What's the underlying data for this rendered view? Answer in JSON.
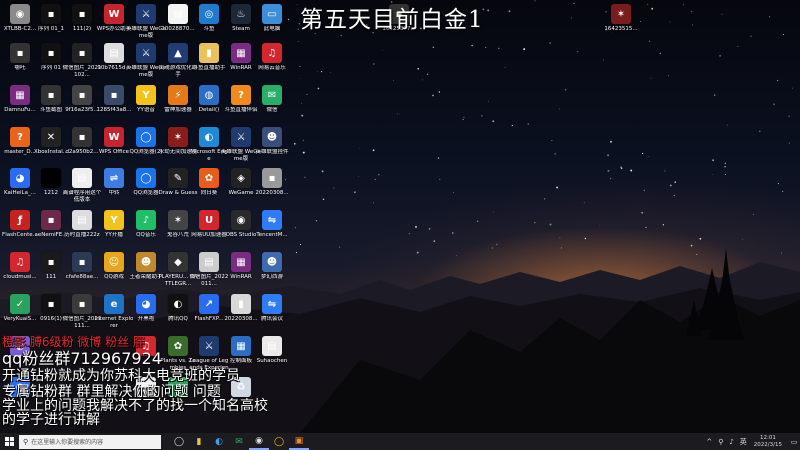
{
  "stream_title": "第五天目前白金1",
  "overlay": {
    "credit_line": "橙影.膊6级粉 微博 粉丝 胖",
    "qq_group": "qq粉丝群712967924",
    "line2": "开通钻粉就成为你苏科大电竞班的学员",
    "line3": "专属钻粉群 群里解决你的问题 问题",
    "line4": "学业上的问题我解决不了的找一个知名高校",
    "line5": "的学子进行讲解"
  },
  "desktop_icons": [
    {
      "id": "xtlbb",
      "label": "XTLBB-C2...",
      "icon": "disc-icon",
      "color": "#8a8a8a",
      "glyph": "◉"
    },
    {
      "id": "xulie1",
      "label": "序列 01_1",
      "icon": "video-file-icon",
      "color": "#111111",
      "glyph": "▪"
    },
    {
      "id": "f111",
      "label": "111(2)",
      "icon": "video-file-icon",
      "color": "#111111",
      "glyph": "▪"
    },
    {
      "id": "wpsyun",
      "label": "WPS办公助手",
      "icon": "wps-icon",
      "color": "#c8242d",
      "glyph": "W"
    },
    {
      "id": "lol-wegame",
      "label": "英雄联盟 WeGame版",
      "icon": "lol-icon",
      "color": "#1e3a6e",
      "glyph": "⚔"
    },
    {
      "id": "f10028",
      "label": "10028870...",
      "icon": "document-icon",
      "color": "#f4f4f4",
      "glyph": "▤"
    },
    {
      "id": "douyu",
      "label": "斗鱼",
      "icon": "edge-like-icon",
      "color": "#1f7ad0",
      "glyph": "◎"
    },
    {
      "id": "steam",
      "label": "Steam",
      "icon": "steam-icon",
      "color": "#1b2838",
      "glyph": "♨"
    },
    {
      "id": "thispc",
      "label": "此电脑",
      "icon": "computer-icon",
      "color": "#3c8ed8",
      "glyph": "▭"
    },
    {
      "id": "nezha",
      "label": "哪吒",
      "icon": "video-file-icon",
      "color": "#333333",
      "glyph": "▪"
    },
    {
      "id": "xulie01",
      "label": "序列 01",
      "icon": "video-file-icon",
      "color": "#111111",
      "glyph": "▪"
    },
    {
      "id": "wxtp",
      "label": "微信图片_2021102...",
      "icon": "image-file-icon",
      "color": "#222222",
      "glyph": "▪"
    },
    {
      "id": "f90b",
      "label": "90b7615d...",
      "icon": "image-file-icon",
      "color": "#dddddd",
      "glyph": "▤"
    },
    {
      "id": "lol-wegame2",
      "label": "英雄联盟 WeGame版",
      "icon": "lol-icon",
      "color": "#1e3a6e",
      "glyph": "⚔"
    },
    {
      "id": "lolhelper",
      "label": "灵魂游戏优化助手",
      "icon": "triangle-app-icon",
      "color": "#233b73",
      "glyph": "▲"
    },
    {
      "id": "douyuzb",
      "label": "斗鱼直播助手",
      "icon": "folder-icon",
      "color": "#e9c25a",
      "glyph": "▮"
    },
    {
      "id": "winrar",
      "label": "WinRAR",
      "icon": "winrar-icon",
      "color": "#7a2b82",
      "glyph": "▦"
    },
    {
      "id": "neteasemusic",
      "label": "网易云音乐",
      "icon": "music-icon",
      "color": "#d4262f",
      "glyph": "♫"
    },
    {
      "id": "damnfu",
      "label": "DamnuFu...",
      "icon": "winrar-icon",
      "color": "#7a2b82",
      "glyph": "▦"
    },
    {
      "id": "douyushot",
      "label": "斗鱼截图",
      "icon": "image-file-icon",
      "color": "#333333",
      "glyph": "▪"
    },
    {
      "id": "f9a",
      "label": "9f16a23f5...",
      "icon": "image-file-icon",
      "color": "#444444",
      "glyph": "▪"
    },
    {
      "id": "f128",
      "label": "1285f43a8...",
      "icon": "image-file-icon",
      "color": "#3a4a6a",
      "glyph": "▪"
    },
    {
      "id": "yy",
      "label": "YY语音",
      "icon": "yy-icon",
      "color": "#f2c31a",
      "glyph": "Y"
    },
    {
      "id": "leishen",
      "label": "雷神加速器",
      "icon": "thunder-icon",
      "color": "#e37a1a",
      "glyph": "⚡"
    },
    {
      "id": "detail",
      "label": "Detail()",
      "icon": "globe-icon",
      "color": "#2b6cc4",
      "glyph": "◍"
    },
    {
      "id": "douyuzbj",
      "label": "斗鱼直播伴侣",
      "icon": "douyu-icon",
      "color": "#f08a1c",
      "glyph": "?"
    },
    {
      "id": "wechat",
      "label": "微信",
      "icon": "wechat-icon",
      "color": "#2aae67",
      "glyph": "✉"
    },
    {
      "id": "master",
      "label": "master_D...",
      "icon": "app-icon",
      "color": "#e8631c",
      "glyph": "?"
    },
    {
      "id": "xbox",
      "label": "XboxInstal...",
      "icon": "xbox-icon",
      "color": "#222222",
      "glyph": "✕"
    },
    {
      "id": "d2",
      "label": "d2a950b2...",
      "icon": "image-file-icon",
      "color": "#333333",
      "glyph": "▪"
    },
    {
      "id": "wps",
      "label": "WPS Office",
      "icon": "wps-icon",
      "color": "#c8242d",
      "glyph": "W"
    },
    {
      "id": "qqbrowser",
      "label": "QQ浏览器(2)",
      "icon": "qq-browser-icon",
      "color": "#1a73e8",
      "glyph": "◯"
    },
    {
      "id": "yongjie",
      "label": "永劫无间加速器",
      "icon": "game-icon",
      "color": "#8a1c1c",
      "glyph": "✶"
    },
    {
      "id": "msedge",
      "label": "Microsoft Edge",
      "icon": "edge-icon",
      "color": "#1e8ad6",
      "glyph": "◐"
    },
    {
      "id": "lol3",
      "label": "英雄联盟 WeGame版",
      "icon": "lol-icon",
      "color": "#1e3a6e",
      "glyph": "⚔"
    },
    {
      "id": "jiadian",
      "label": "英雄联盟挂件",
      "icon": "character-icon",
      "color": "#3a4e7a",
      "glyph": "☻"
    },
    {
      "id": "kaiheila",
      "label": "KaiHeiLa_...",
      "icon": "kaiheila-icon",
      "color": "#2a6cf0",
      "glyph": "◕"
    },
    {
      "id": "f1212",
      "label": "1212",
      "icon": "blank-file-icon",
      "color": "#000000",
      "glyph": ""
    },
    {
      "id": "yingyong",
      "label": "离谱程序用这个低版本",
      "icon": "document-icon",
      "color": "#eeeeee",
      "glyph": "▤"
    },
    {
      "id": "zhongxin",
      "label": "中转",
      "icon": "app-icon",
      "color": "#3b7de0",
      "glyph": "⇌"
    },
    {
      "id": "qqbrowser2",
      "label": "QQ浏览器",
      "icon": "qq-browser-icon",
      "color": "#1a73e8",
      "glyph": "◯"
    },
    {
      "id": "drawguess",
      "label": "Draw & Guess",
      "icon": "pen-icon",
      "color": "#222222",
      "glyph": "✎"
    },
    {
      "id": "xiangrile",
      "label": "向日葵",
      "icon": "sunflower-icon",
      "color": "#e85c1c",
      "glyph": "✿"
    },
    {
      "id": "wegame",
      "label": "WeGame",
      "icon": "wegame-icon",
      "color": "#222222",
      "glyph": "◈"
    },
    {
      "id": "f202203",
      "label": "20220308...",
      "icon": "image-file-icon",
      "color": "#999999",
      "glyph": "▪"
    },
    {
      "id": "flashcenter",
      "label": "FlashCente...",
      "icon": "flash-icon",
      "color": "#c82121",
      "glyph": "ƒ"
    },
    {
      "id": "aeriemini",
      "label": "aeNemiFE...",
      "icon": "photo-icon",
      "color": "#6b2a4a",
      "glyph": "▪"
    },
    {
      "id": "fyyy",
      "label": "历时直播222z",
      "icon": "text-file-icon",
      "color": "#dddddd",
      "glyph": "▤"
    },
    {
      "id": "yykaibo",
      "label": "YY开播",
      "icon": "yy-icon",
      "color": "#f2c31a",
      "glyph": "Y"
    },
    {
      "id": "qqmusic",
      "label": "QQ音乐",
      "icon": "qq-music-icon",
      "color": "#1fbf67",
      "glyph": "♪"
    },
    {
      "id": "guiyu",
      "label": "鬼谷八荒",
      "icon": "game-icon",
      "color": "#444444",
      "glyph": "✶"
    },
    {
      "id": "uuacc",
      "label": "网易UU加速器",
      "icon": "uu-icon",
      "color": "#d4262f",
      "glyph": "U"
    },
    {
      "id": "obs",
      "label": "OBS Studio",
      "icon": "obs-icon",
      "color": "#2a2a2a",
      "glyph": "◉"
    },
    {
      "id": "tencentm",
      "label": "TencentM...",
      "icon": "tencent-meeting-icon",
      "color": "#2f7cf6",
      "glyph": "⇋"
    },
    {
      "id": "cloudmusic",
      "label": "cloudmusi...",
      "icon": "music-icon",
      "color": "#d4262f",
      "glyph": "♫"
    },
    {
      "id": "f111b",
      "label": "111",
      "icon": "video-file-icon",
      "color": "#1a1a1a",
      "glyph": "▪"
    },
    {
      "id": "cfafe",
      "label": "cfafe88ae...",
      "icon": "image-file-icon",
      "color": "#2b3a55",
      "glyph": "▪"
    },
    {
      "id": "qqgame",
      "label": "QQ游戏",
      "icon": "qq-game-icon",
      "color": "#e9a61c",
      "glyph": "☺"
    },
    {
      "id": "wangzhe",
      "label": "王者荣耀助手",
      "icon": "character-icon",
      "color": "#c08a2c",
      "glyph": "☻"
    },
    {
      "id": "pubg",
      "label": "PLAYERU... BATTLEGR...",
      "icon": "pubg-icon",
      "color": "#333333",
      "glyph": "◆"
    },
    {
      "id": "wxtp2",
      "label": "微信图片_2022011...",
      "icon": "image-file-icon",
      "color": "#cccccc",
      "glyph": "▤"
    },
    {
      "id": "winrar2",
      "label": "WinRAR",
      "icon": "winrar-icon",
      "color": "#7a2b82",
      "glyph": "▦"
    },
    {
      "id": "mengji",
      "label": "梦幻西游",
      "icon": "character-icon",
      "color": "#3e6ab0",
      "glyph": "☻"
    },
    {
      "id": "verykuai",
      "label": "VeryKuaiS...",
      "icon": "green-app-icon",
      "color": "#2aa15e",
      "glyph": "✓"
    },
    {
      "id": "f0916",
      "label": "0916(1)",
      "icon": "video-file-icon",
      "color": "#111111",
      "glyph": "▪"
    },
    {
      "id": "wxtp3",
      "label": "微信图片_2021111...",
      "icon": "image-file-icon",
      "color": "#3a3a3a",
      "glyph": "▪"
    },
    {
      "id": "ie",
      "label": "Internet Explorer",
      "icon": "ie-icon",
      "color": "#1e73c8",
      "glyph": "e"
    },
    {
      "id": "kaiheila2",
      "label": "开黑啦",
      "icon": "kaiheila-icon",
      "color": "#2a6cf0",
      "glyph": "◕"
    },
    {
      "id": "tengxunqq",
      "label": "腾讯QQ",
      "icon": "qq-icon",
      "color": "#111111",
      "glyph": "◐"
    },
    {
      "id": "flashfxp",
      "label": "FlashFXP...",
      "icon": "flashfxp-icon",
      "color": "#2a6cf0",
      "glyph": "↗"
    },
    {
      "id": "f20220308",
      "label": "20220308...",
      "icon": "folder-icon",
      "color": "#d8d8d8",
      "glyph": "▮"
    },
    {
      "id": "tencentmeeting",
      "label": "腾讯会议",
      "icon": "tencent-meeting-icon",
      "color": "#2f7cf6",
      "glyph": "⇋"
    },
    {
      "id": "qqgroup1",
      "label": "",
      "icon": "qq-icon",
      "color": "#7a5cd0",
      "glyph": "◐"
    },
    {
      "id": "qqgroup2",
      "label": "",
      "icon": "music-icon",
      "color": "#d4262f",
      "glyph": "♫"
    },
    {
      "id": "pvz",
      "label": "Plants vs. Zombies",
      "icon": "pvz-icon",
      "color": "#3a6b2a",
      "glyph": "✿"
    },
    {
      "id": "lolexp",
      "label": "League of Legends Experience",
      "icon": "lol-icon",
      "color": "#1e3a6e",
      "glyph": "⚔"
    },
    {
      "id": "controlpanel",
      "label": "控制面板",
      "icon": "control-panel-icon",
      "color": "#2b6cc4",
      "glyph": "▦"
    },
    {
      "id": "subaochen",
      "label": "Suhaochen",
      "icon": "document-icon",
      "color": "#eaeaea",
      "glyph": "▤"
    },
    {
      "id": "kaiheila3",
      "label": "",
      "icon": "kaiheila-icon",
      "color": "#2a6cf0",
      "glyph": "◕"
    },
    {
      "id": "notepad",
      "label": "",
      "icon": "document-icon",
      "color": "#eeeeee",
      "glyph": "▤"
    },
    {
      "id": "greenapp",
      "label": "",
      "icon": "green-app-icon",
      "color": "#2aa15e",
      "glyph": "✓"
    },
    {
      "id": "recyclebin",
      "label": "",
      "icon": "recycle-bin-icon",
      "color": "#cfd8e3",
      "glyph": "♻"
    }
  ],
  "corner_icons": [
    {
      "id": "top-icon-1",
      "label": "16425377...",
      "icon": "image-file-icon",
      "color": "#333333",
      "glyph": "▪"
    },
    {
      "id": "top-icon-2",
      "label": "16423515...",
      "icon": "game-icon",
      "color": "#7a1c1c",
      "glyph": "✶"
    }
  ],
  "taskbar": {
    "search_placeholder": "在这里输入你要搜索的内容",
    "apps": [
      {
        "id": "task-view",
        "icon": "task-view-icon",
        "glyph": "◯",
        "color": "#dddddd"
      },
      {
        "id": "file-explorer",
        "icon": "folder-icon",
        "glyph": "▮",
        "color": "#f0c040"
      },
      {
        "id": "edge",
        "icon": "edge-icon",
        "glyph": "◐",
        "color": "#3aa0f0"
      },
      {
        "id": "wechat",
        "icon": "wechat-icon",
        "glyph": "✉",
        "color": "#2aae67"
      },
      {
        "id": "obs",
        "icon": "obs-icon",
        "glyph": "◉",
        "color": "#dddddd",
        "active": true
      },
      {
        "id": "yy",
        "icon": "yy-icon",
        "glyph": "◯",
        "color": "#f2c31a"
      },
      {
        "id": "douyu",
        "icon": "douyu-icon",
        "glyph": "▣",
        "color": "#f08a1c",
        "active": true
      }
    ],
    "tray": {
      "chevron": "^",
      "network": "⚲",
      "volume": "♪",
      "ime": "英",
      "time": "12:01",
      "date": "2022/3/15"
    }
  },
  "colors": {
    "taskbar_bg": "#1b1b20",
    "credit_red": "#e8282e",
    "overlay_text": "#ffffff"
  }
}
